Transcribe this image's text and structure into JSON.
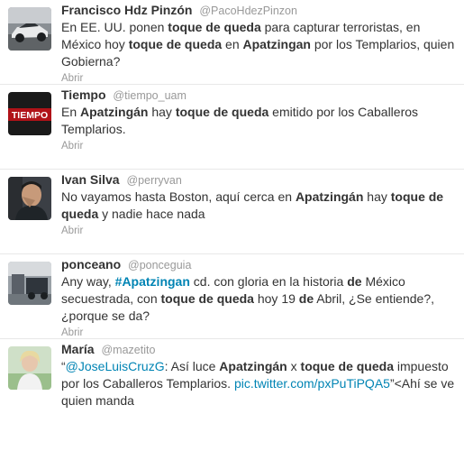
{
  "tweets": [
    {
      "name": "Francisco Hdz Pinzón",
      "handle": "@PacoHdezPinzon",
      "avatar_icon": "race-car-avatar",
      "text": [
        {
          "t": "En EE. UU. ponen "
        },
        {
          "t": "toque de queda",
          "b": true
        },
        {
          "t": " para capturar terroristas, en México hoy "
        },
        {
          "t": "toque de queda",
          "b": true
        },
        {
          "t": " en "
        },
        {
          "t": "Apatzingan",
          "b": true
        },
        {
          "t": " por los Templarios, quien Gobierna?"
        }
      ],
      "action": "Abrir"
    },
    {
      "name": "Tiempo",
      "handle": "@tiempo_uam",
      "avatar_icon": "tiempo-logo-avatar",
      "avatar_text": "TIEMPO",
      "text": [
        {
          "t": "En "
        },
        {
          "t": "Apatzingán",
          "b": true
        },
        {
          "t": " hay "
        },
        {
          "t": "toque de queda",
          "b": true
        },
        {
          "t": " emitido por los Caballeros Templarios."
        }
      ],
      "action": "Abrir"
    },
    {
      "name": "Ivan Silva",
      "handle": "@perryvan",
      "avatar_icon": "person-avatar",
      "text": [
        {
          "t": "No vayamos hasta Boston, aquí cerca en "
        },
        {
          "t": "Apatzingán",
          "b": true
        },
        {
          "t": " hay "
        },
        {
          "t": "toque de queda",
          "b": true
        },
        {
          "t": " y nadie hace nada"
        }
      ],
      "action": "Abrir"
    },
    {
      "name": "ponceano",
      "handle": "@ponceguia",
      "avatar_icon": "street-photo-avatar",
      "text": [
        {
          "t": "Any way, "
        },
        {
          "t": "#Apatzingan",
          "h": true
        },
        {
          "t": " cd. con gloria en la historia "
        },
        {
          "t": "de",
          "b": true
        },
        {
          "t": " México secuestrada, con "
        },
        {
          "t": "toque de queda",
          "b": true
        },
        {
          "t": " hoy 19 "
        },
        {
          "t": "de",
          "b": true
        },
        {
          "t": " Abril, ¿Se entiende?, ¿porque se da?"
        }
      ],
      "action": "Abrir"
    },
    {
      "name": "María",
      "handle": "@mazetito",
      "avatar_icon": "woman-avatar",
      "text": [
        {
          "t": "“"
        },
        {
          "t": "@JoseLuisCruzG",
          "l": true
        },
        {
          "t": ": Así luce "
        },
        {
          "t": "Apatzingán",
          "b": true
        },
        {
          "t": " x  "
        },
        {
          "t": "toque de queda",
          "b": true
        },
        {
          "t": " impuesto por los Caballeros Templarios. "
        },
        {
          "t": "pic.twitter.com/pxPuTiPQA5",
          "l": true
        },
        {
          "t": "”<Ahí se ve quien manda"
        }
      ],
      "action": ""
    }
  ]
}
